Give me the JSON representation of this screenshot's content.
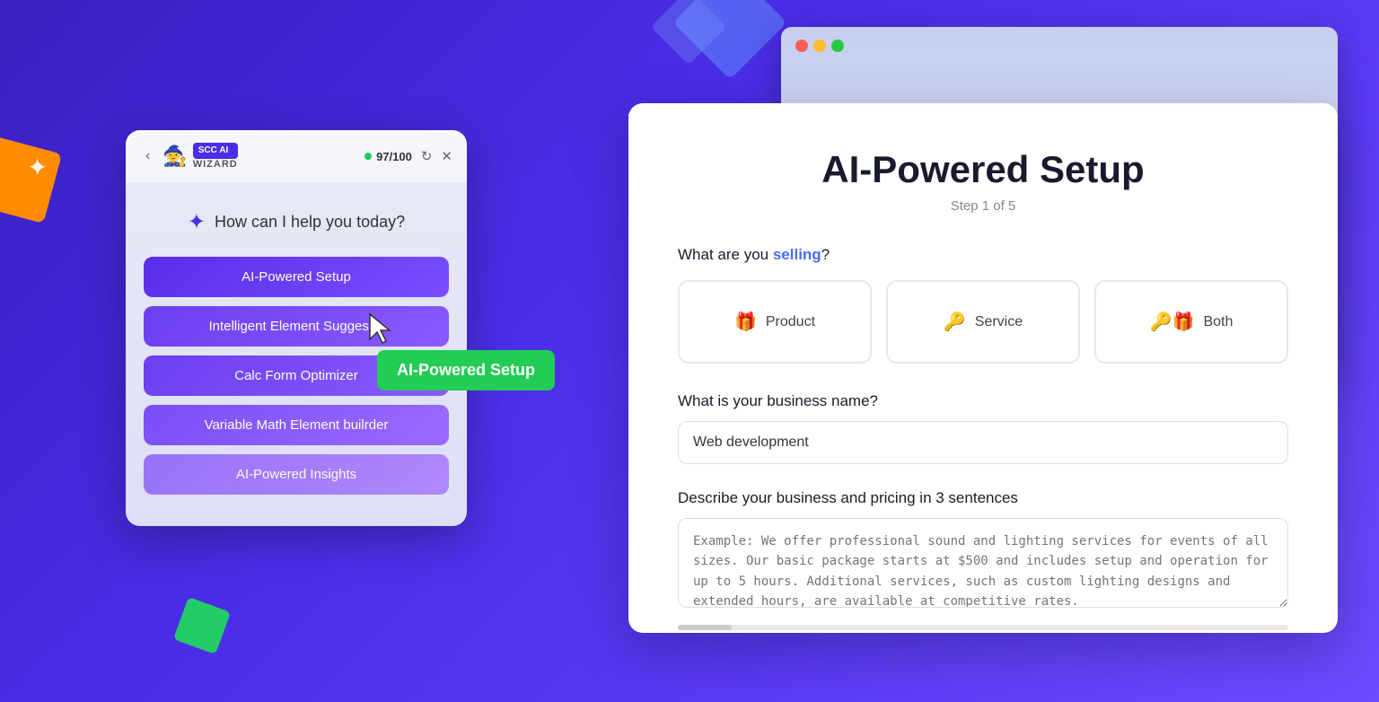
{
  "background": {
    "color": "#4b2de8"
  },
  "browser_chrome": {
    "dots": [
      "red",
      "yellow",
      "green"
    ]
  },
  "main_card": {
    "title": "AI-Powered Setup",
    "step_indicator": "Step 1 of 5",
    "selling_question": "What are you",
    "selling_highlight": "selling",
    "selling_question_end": "?",
    "selling_options": [
      {
        "label": "Product",
        "icon": "🎁"
      },
      {
        "label": "Service",
        "icon": "🔑"
      },
      {
        "label": "Both",
        "icon": "🔑🎁"
      }
    ],
    "business_name_label": "What is your business name?",
    "business_name_value": "Web development",
    "description_label": "Describe your business and pricing in 3 sentences",
    "description_placeholder": "Example: We offer professional sound and lighting services for events of all sizes. Our basic package starts at $500 and includes setup and operation for up to 5 hours. Additional services, such as custom lighting designs and extended hours, are available at competitive rates."
  },
  "widget": {
    "back_btn": "‹",
    "logo_text": "SCC AI",
    "logo_sub": "WIZARD",
    "score": "97/100",
    "help_text": "How can I help you today?",
    "menu_items": [
      "AI-Powered Setup",
      "Intelligent Element Suggest...",
      "Calc Form Optimizer",
      "Variable Math Element builrder",
      "AI-Powered Insights"
    ]
  },
  "tooltip": {
    "text": "AI-Powered Setup"
  }
}
